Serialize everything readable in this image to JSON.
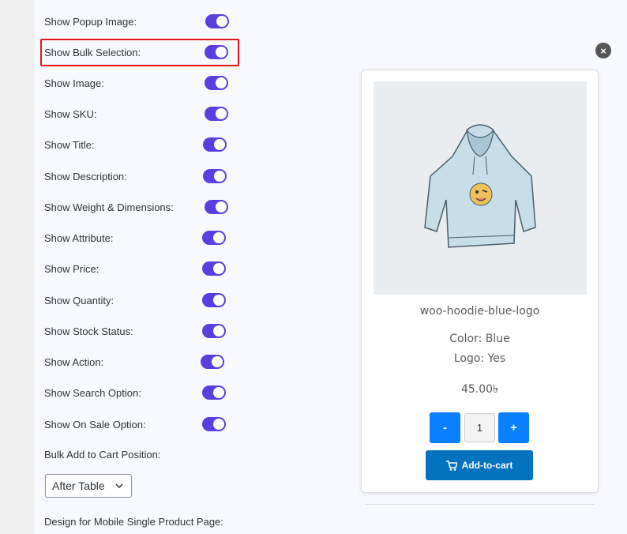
{
  "settings": {
    "toggles": [
      {
        "label": "Show Popup Image:",
        "on": true
      },
      {
        "label": "Show Bulk Selection:",
        "on": true
      },
      {
        "label": "Show Image:",
        "on": true
      },
      {
        "label": "Show SKU:",
        "on": true
      },
      {
        "label": "Show Title:",
        "on": true
      },
      {
        "label": "Show Description:",
        "on": true
      },
      {
        "label": "Show Weight & Dimensions:",
        "on": true
      },
      {
        "label": "Show Attribute:",
        "on": true
      },
      {
        "label": "Show Price:",
        "on": true
      },
      {
        "label": "Show Quantity:",
        "on": true
      },
      {
        "label": "Show Stock Status:",
        "on": true
      },
      {
        "label": "Show Action:",
        "on": true
      },
      {
        "label": "Show Search Option:",
        "on": true
      },
      {
        "label": "Show On Sale Option:",
        "on": true
      }
    ],
    "bulk_position_label": "Bulk Add to Cart Position:",
    "bulk_position_value": "After Table",
    "mobile_design_label": "Design for Mobile Single Product Page:"
  },
  "colors": {
    "toggle_on": "#5b3ee0",
    "highlight": "#e3151a",
    "qty_button": "#0a7fff",
    "cart_button": "#0473bf"
  },
  "preview": {
    "close_icon": "×",
    "product_title": "woo-hoodie-blue-logo",
    "attributes": [
      "Color: Blue",
      "Logo: Yes"
    ],
    "price": "45.00৳",
    "qty_minus": "-",
    "qty_value": "1",
    "qty_plus": "+",
    "add_to_cart": "Add-to-cart"
  }
}
